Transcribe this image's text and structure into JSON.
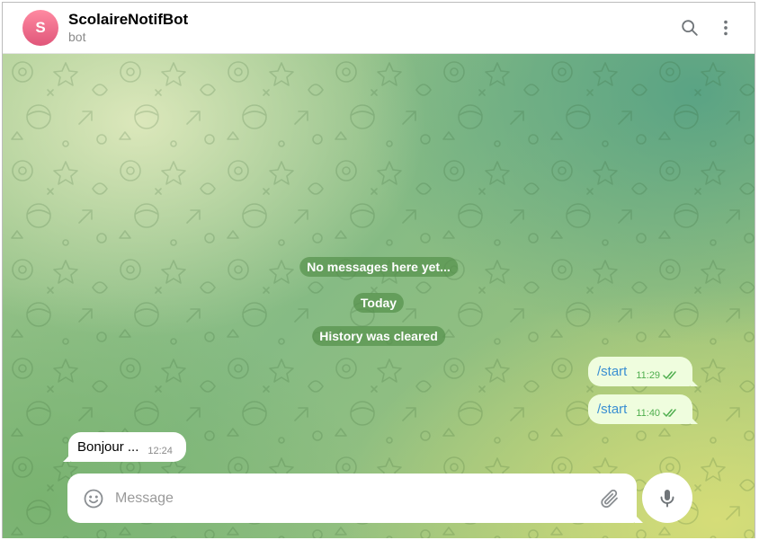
{
  "chat": {
    "avatar_letter": "S",
    "title": "ScolaireNotifBot",
    "subtitle": "bot"
  },
  "header_icons": [
    "search-icon",
    "more-vertical-icon"
  ],
  "service_messages": {
    "empty": "No messages here yet...",
    "date": "Today",
    "cleared": "History was cleared"
  },
  "messages": [
    {
      "direction": "out",
      "text": "/start",
      "time": "11:29",
      "status": "read"
    },
    {
      "direction": "out",
      "text": "/start",
      "time": "11:40",
      "status": "read"
    },
    {
      "direction": "in",
      "text": "Bonjour ...",
      "time": "12:24"
    }
  ],
  "composer": {
    "placeholder": "Message",
    "value": ""
  },
  "colors": {
    "accent": "#3a8fd2",
    "outgoing_bubble": "#effdde",
    "read_check": "#4fae4e",
    "avatar": "#e0567a"
  }
}
